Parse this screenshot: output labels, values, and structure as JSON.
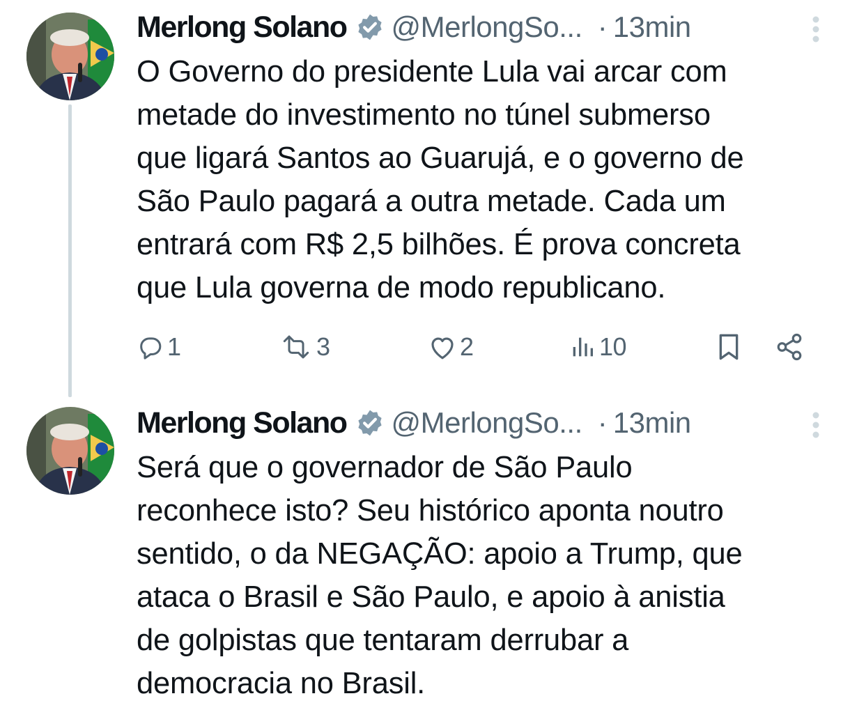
{
  "tweets": [
    {
      "author": {
        "display_name": "Merlong Solano",
        "handle": "@MerlongSo...",
        "verified_icon": "verified-badge-icon"
      },
      "separator": "·",
      "time": "13min",
      "text_lines": [
        "O Governo do presidente Lula vai arcar com",
        "metade do investimento no túnel submerso",
        "que ligará Santos ao Guarujá, e o governo de",
        "São Paulo pagará a outra metade. Cada um",
        "entrará com R$ 2,5 bilhões. É prova concreta",
        "que Lula governa de modo republicano."
      ],
      "actions": {
        "replies": "1",
        "retweets": "3",
        "likes": "2",
        "views": "10"
      }
    },
    {
      "author": {
        "display_name": "Merlong Solano",
        "handle": "@MerlongSo...",
        "verified_icon": "verified-badge-icon"
      },
      "separator": "·",
      "time": "13min",
      "text_lines": [
        "Será que o governador de São Paulo",
        "reconhece isto? Seu histórico aponta noutro",
        "sentido, o da NEGAÇÃO: apoio a Trump, que",
        "ataca o Brasil e São Paulo, e apoio à anistia",
        "de golpistas que tentaram derrubar a",
        "democracia no Brasil."
      ]
    }
  ],
  "colors": {
    "text": "#0f1419",
    "secondary": "#536471",
    "thread_line": "#cfd9de",
    "more_dots": "#cfd9de"
  },
  "icons": [
    "reply-icon",
    "retweet-icon",
    "like-icon",
    "views-icon",
    "bookmark-icon",
    "share-icon",
    "more-options-icon"
  ]
}
